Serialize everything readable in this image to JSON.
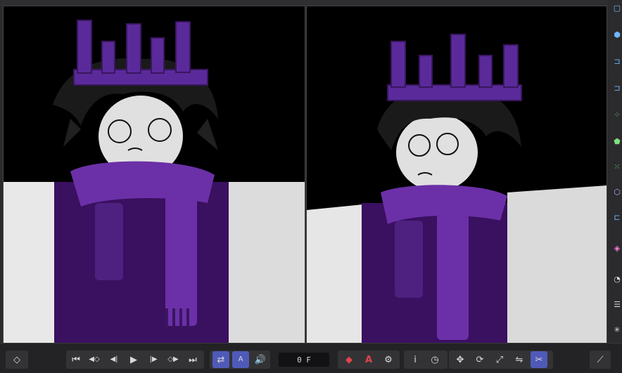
{
  "timeline": {
    "frame_value": "0 F",
    "buttons": {
      "keyframe": "◇",
      "goto_start": "⏮",
      "prev_key": "◀◇",
      "prev_frame": "◀|",
      "play": "▶",
      "next_frame": "|▶",
      "next_key": "◇▶",
      "goto_end": "⏭",
      "loop": "⇄",
      "audio_letter": "A",
      "sound": "🔊",
      "record": "◆",
      "autokey": "A",
      "settings": "⚙",
      "info": "i",
      "speed": "◷",
      "move": "✥",
      "rotate": "⟳",
      "scale": "⤢",
      "toggle": "⇋",
      "snap": "✂",
      "graph": "⟋"
    }
  },
  "right_toolbar": {
    "icons": [
      "cube-outline-icon",
      "cube-blue-icon",
      "bracket-icon",
      "nodes-icon",
      "green-shape-icon",
      "dots-icon",
      "hex-icon",
      "bracket2-icon",
      "pink-shape-icon",
      "st-icon-1",
      "st-icon-2",
      "st-icon-3"
    ]
  },
  "colors": {
    "accent": "#4f5ab8",
    "crown": "#5a2a9a",
    "scarf": "#6b30a8",
    "body_dark": "#3a1060",
    "record_red": "#e0464a"
  }
}
